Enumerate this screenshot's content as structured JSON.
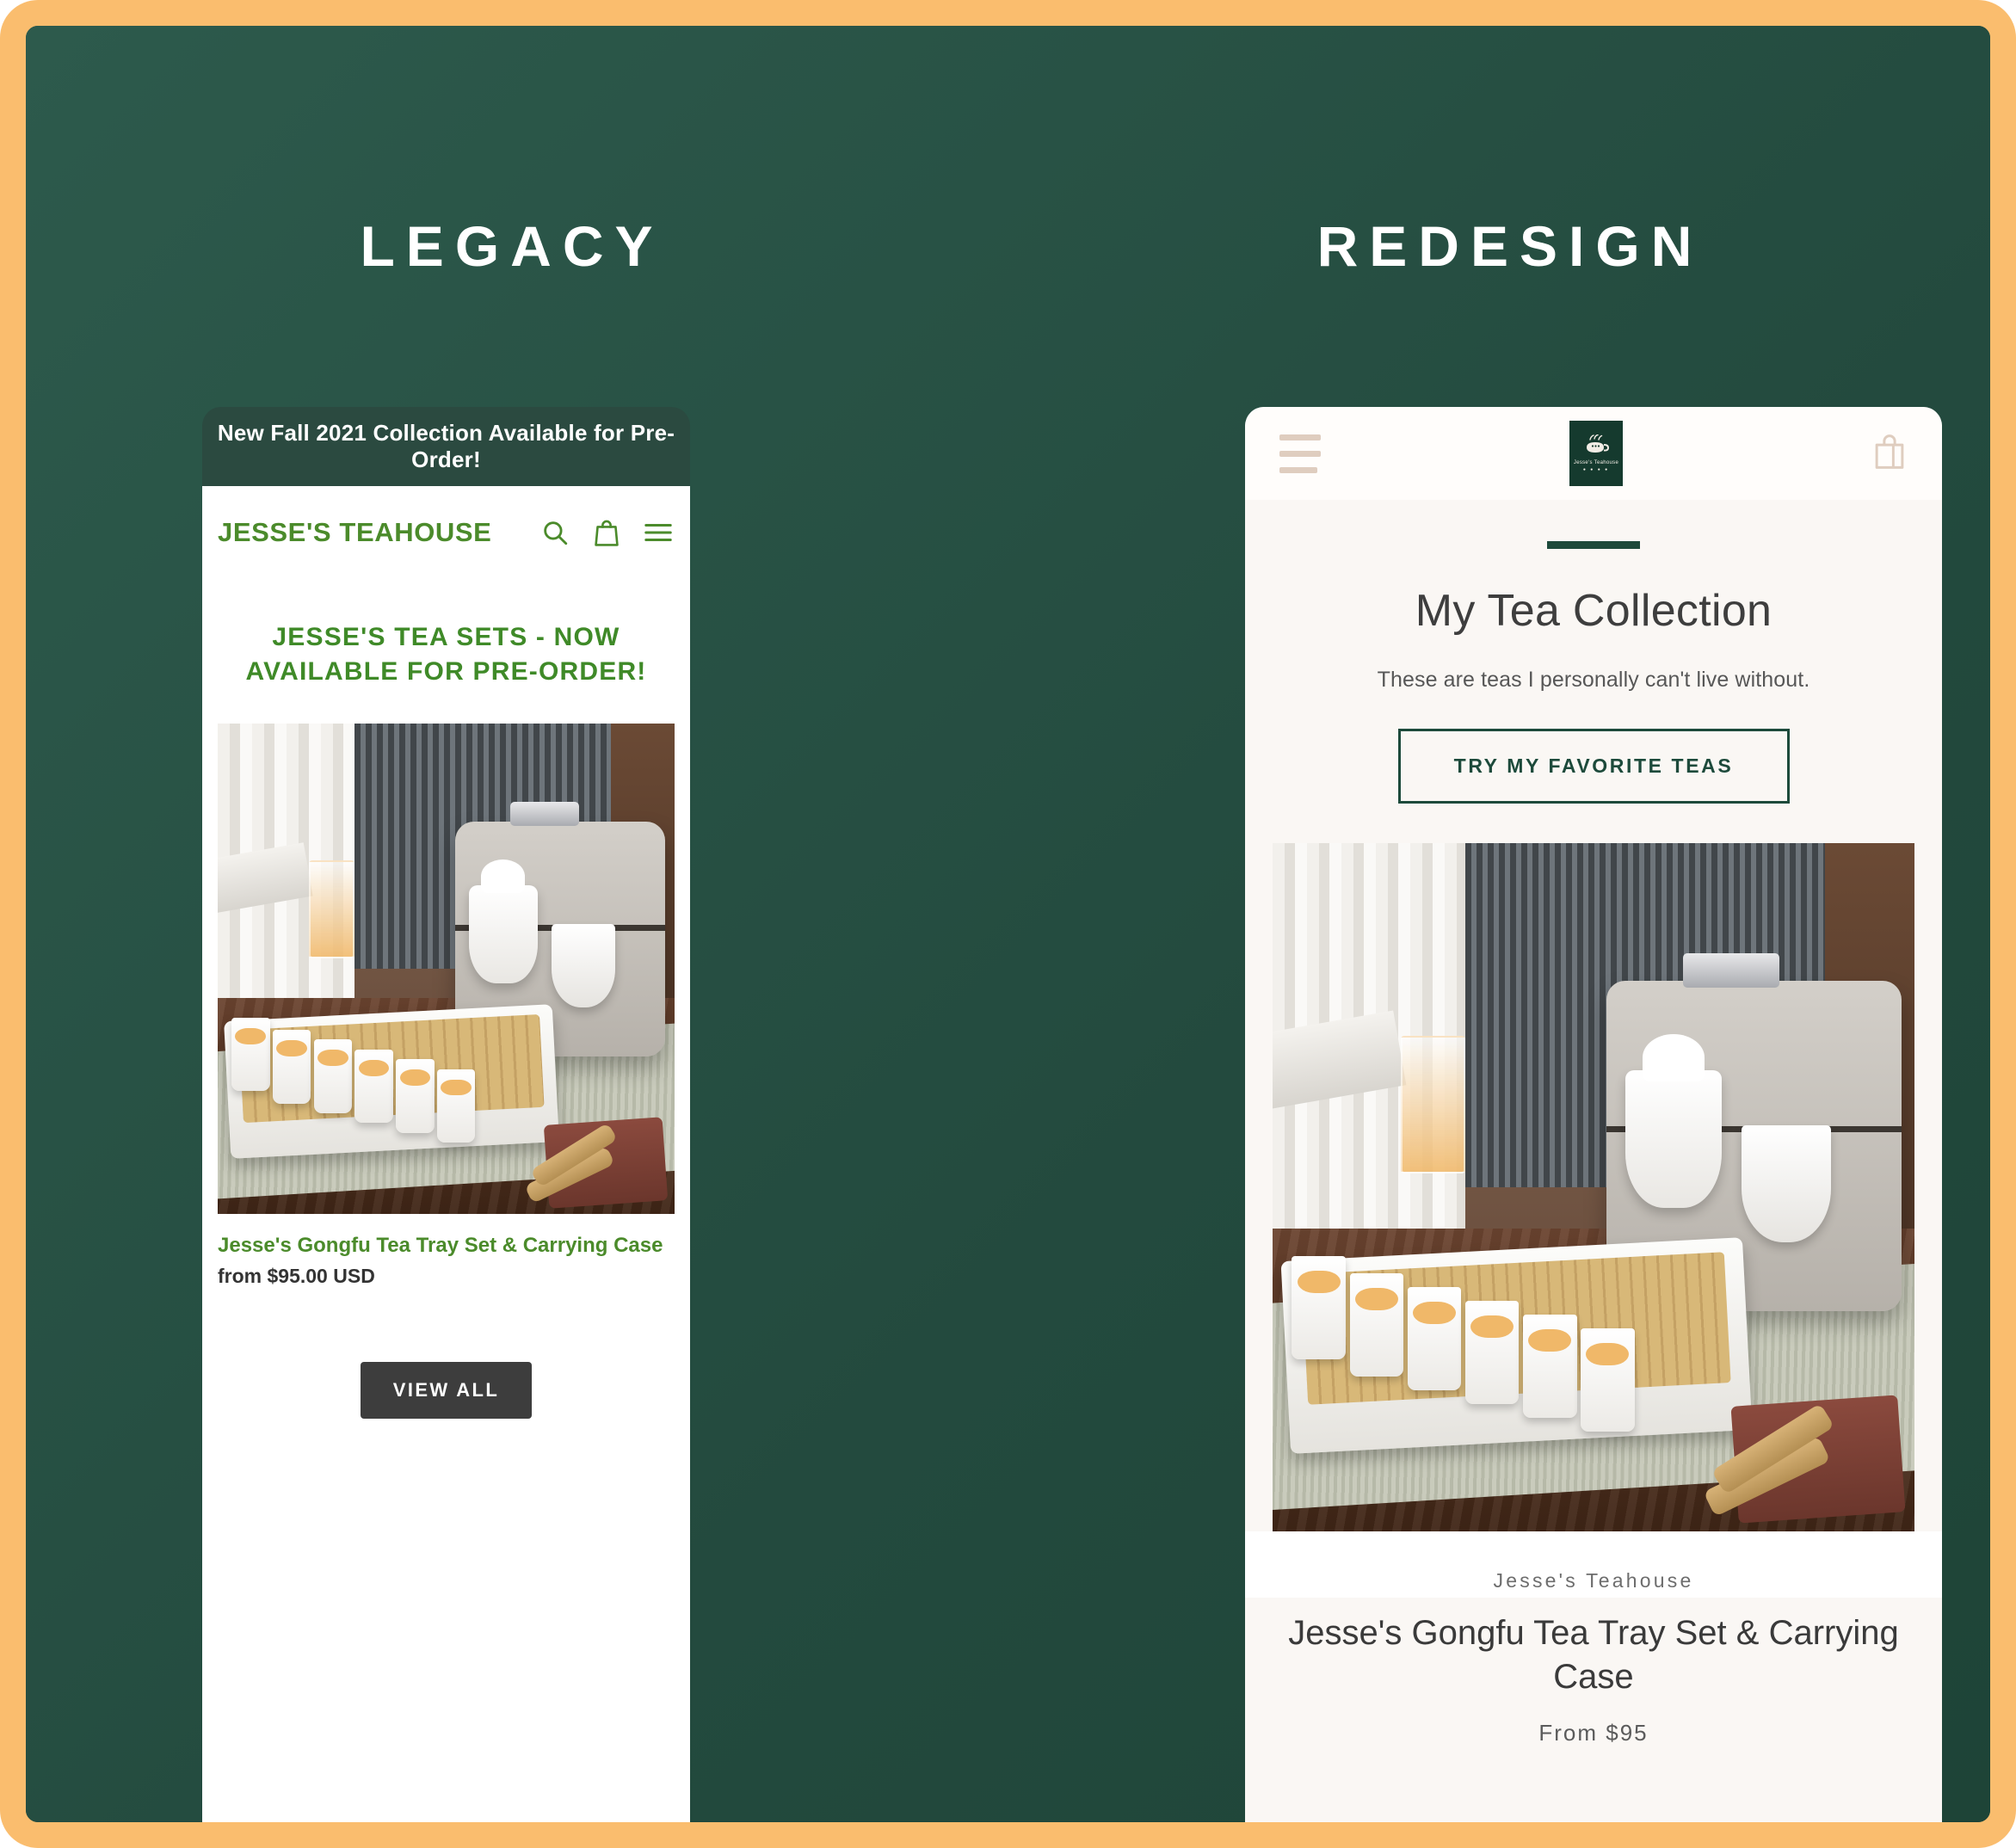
{
  "columns": {
    "legacy_label": "LEGACY",
    "redesign_label": "REDESIGN"
  },
  "colors": {
    "page_border": "#FABD6E",
    "backdrop_green": "#2A5348",
    "legacy_accent_green": "#4B8B2B",
    "legacy_banner_bg": "#2B4A40",
    "legacy_button_bg": "#3D3D3D",
    "redesign_accent_green": "#1D4A3B",
    "redesign_surface": "#FAF7F4",
    "redesign_icon_tan": "#DFCDBF"
  },
  "legacy": {
    "announcement_bar": "New Fall 2021 Collection Available for Pre-Order!",
    "logo": "JESSE'S TEAHOUSE",
    "icons": [
      "search-icon",
      "shopping-bag-icon",
      "hamburger-menu-icon"
    ],
    "headline": "JESSE'S TEA SETS - NOW AVAILABLE FOR PRE-ORDER!",
    "product": {
      "title": "Jesse's Gongfu Tea Tray Set & Carrying Case",
      "price": "from $95.00 USD",
      "image_alt": "Gongfu tea tray set with white cups and gray carrying case"
    },
    "view_all_label": "VIEW ALL"
  },
  "redesign": {
    "icons": [
      "hamburger-menu-icon",
      "brand-logo-teapot",
      "shopping-bag-icon"
    ],
    "logo_caption": "Jesse's Teahouse",
    "logo_dots": "● ● ● ●",
    "heading": "My Tea Collection",
    "subheading": "These are teas I personally can't live without.",
    "cta_label": "TRY MY FAVORITE TEAS",
    "product": {
      "vendor": "Jesse's Teahouse",
      "title": "Jesse's Gongfu Tea Tray Set & Carrying Case",
      "price": "From $95",
      "image_alt": "Gongfu tea tray set with white cups and gray carrying case"
    }
  }
}
